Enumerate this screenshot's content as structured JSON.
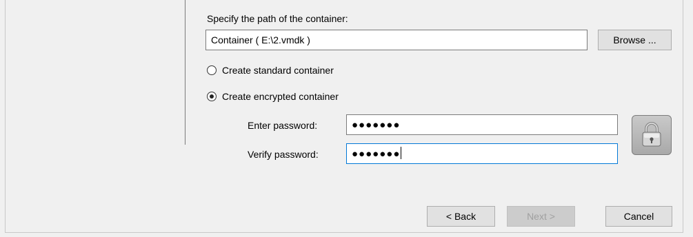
{
  "path_section": {
    "label": "Specify the path of the container:",
    "path_value": "Container ( E:\\2.vmdk )",
    "browse_label": "Browse ..."
  },
  "options": {
    "standard_label": "Create standard container",
    "encrypted_label": "Create encrypted container",
    "selected": "encrypted"
  },
  "password": {
    "enter_label": "Enter password:",
    "enter_value": "●●●●●●●",
    "verify_label": "Verify password:",
    "verify_value": "●●●●●●●"
  },
  "buttons": {
    "back_label": "< Back",
    "next_label": "Next >",
    "cancel_label": "Cancel"
  },
  "icons": {
    "lock": "lock-icon"
  }
}
